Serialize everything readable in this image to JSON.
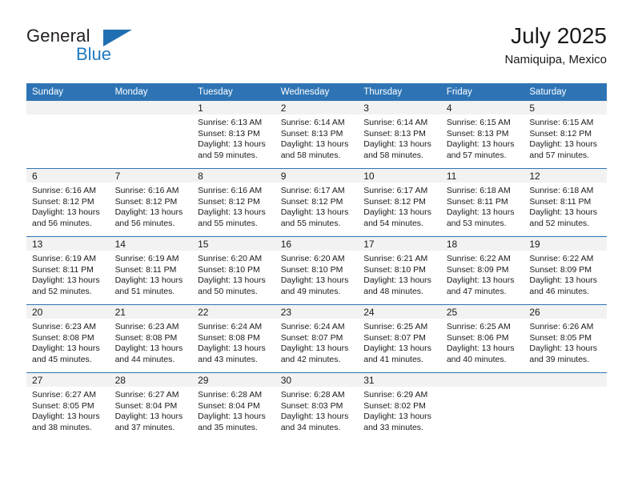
{
  "brand": {
    "name_part1": "General",
    "name_part2": "Blue",
    "triangle_color": "#1f6fb2",
    "blue_text_color": "#1f7ac0"
  },
  "header": {
    "title": "July 2025",
    "subtitle": "Namiquipa, Mexico"
  },
  "theme": {
    "header_blue": "#2e74b5",
    "band_gray": "#f2f2f2",
    "text": "#1a1a1a"
  },
  "calendar": {
    "weekday_headers": [
      "Sunday",
      "Monday",
      "Tuesday",
      "Wednesday",
      "Thursday",
      "Friday",
      "Saturday"
    ],
    "weeks": [
      [
        {
          "day": "",
          "sunrise": "",
          "sunset": "",
          "daylight": ""
        },
        {
          "day": "",
          "sunrise": "",
          "sunset": "",
          "daylight": ""
        },
        {
          "day": "1",
          "sunrise": "Sunrise: 6:13 AM",
          "sunset": "Sunset: 8:13 PM",
          "daylight": "Daylight: 13 hours and 59 minutes."
        },
        {
          "day": "2",
          "sunrise": "Sunrise: 6:14 AM",
          "sunset": "Sunset: 8:13 PM",
          "daylight": "Daylight: 13 hours and 58 minutes."
        },
        {
          "day": "3",
          "sunrise": "Sunrise: 6:14 AM",
          "sunset": "Sunset: 8:13 PM",
          "daylight": "Daylight: 13 hours and 58 minutes."
        },
        {
          "day": "4",
          "sunrise": "Sunrise: 6:15 AM",
          "sunset": "Sunset: 8:13 PM",
          "daylight": "Daylight: 13 hours and 57 minutes."
        },
        {
          "day": "5",
          "sunrise": "Sunrise: 6:15 AM",
          "sunset": "Sunset: 8:12 PM",
          "daylight": "Daylight: 13 hours and 57 minutes."
        }
      ],
      [
        {
          "day": "6",
          "sunrise": "Sunrise: 6:16 AM",
          "sunset": "Sunset: 8:12 PM",
          "daylight": "Daylight: 13 hours and 56 minutes."
        },
        {
          "day": "7",
          "sunrise": "Sunrise: 6:16 AM",
          "sunset": "Sunset: 8:12 PM",
          "daylight": "Daylight: 13 hours and 56 minutes."
        },
        {
          "day": "8",
          "sunrise": "Sunrise: 6:16 AM",
          "sunset": "Sunset: 8:12 PM",
          "daylight": "Daylight: 13 hours and 55 minutes."
        },
        {
          "day": "9",
          "sunrise": "Sunrise: 6:17 AM",
          "sunset": "Sunset: 8:12 PM",
          "daylight": "Daylight: 13 hours and 55 minutes."
        },
        {
          "day": "10",
          "sunrise": "Sunrise: 6:17 AM",
          "sunset": "Sunset: 8:12 PM",
          "daylight": "Daylight: 13 hours and 54 minutes."
        },
        {
          "day": "11",
          "sunrise": "Sunrise: 6:18 AM",
          "sunset": "Sunset: 8:11 PM",
          "daylight": "Daylight: 13 hours and 53 minutes."
        },
        {
          "day": "12",
          "sunrise": "Sunrise: 6:18 AM",
          "sunset": "Sunset: 8:11 PM",
          "daylight": "Daylight: 13 hours and 52 minutes."
        }
      ],
      [
        {
          "day": "13",
          "sunrise": "Sunrise: 6:19 AM",
          "sunset": "Sunset: 8:11 PM",
          "daylight": "Daylight: 13 hours and 52 minutes."
        },
        {
          "day": "14",
          "sunrise": "Sunrise: 6:19 AM",
          "sunset": "Sunset: 8:11 PM",
          "daylight": "Daylight: 13 hours and 51 minutes."
        },
        {
          "day": "15",
          "sunrise": "Sunrise: 6:20 AM",
          "sunset": "Sunset: 8:10 PM",
          "daylight": "Daylight: 13 hours and 50 minutes."
        },
        {
          "day": "16",
          "sunrise": "Sunrise: 6:20 AM",
          "sunset": "Sunset: 8:10 PM",
          "daylight": "Daylight: 13 hours and 49 minutes."
        },
        {
          "day": "17",
          "sunrise": "Sunrise: 6:21 AM",
          "sunset": "Sunset: 8:10 PM",
          "daylight": "Daylight: 13 hours and 48 minutes."
        },
        {
          "day": "18",
          "sunrise": "Sunrise: 6:22 AM",
          "sunset": "Sunset: 8:09 PM",
          "daylight": "Daylight: 13 hours and 47 minutes."
        },
        {
          "day": "19",
          "sunrise": "Sunrise: 6:22 AM",
          "sunset": "Sunset: 8:09 PM",
          "daylight": "Daylight: 13 hours and 46 minutes."
        }
      ],
      [
        {
          "day": "20",
          "sunrise": "Sunrise: 6:23 AM",
          "sunset": "Sunset: 8:08 PM",
          "daylight": "Daylight: 13 hours and 45 minutes."
        },
        {
          "day": "21",
          "sunrise": "Sunrise: 6:23 AM",
          "sunset": "Sunset: 8:08 PM",
          "daylight": "Daylight: 13 hours and 44 minutes."
        },
        {
          "day": "22",
          "sunrise": "Sunrise: 6:24 AM",
          "sunset": "Sunset: 8:08 PM",
          "daylight": "Daylight: 13 hours and 43 minutes."
        },
        {
          "day": "23",
          "sunrise": "Sunrise: 6:24 AM",
          "sunset": "Sunset: 8:07 PM",
          "daylight": "Daylight: 13 hours and 42 minutes."
        },
        {
          "day": "24",
          "sunrise": "Sunrise: 6:25 AM",
          "sunset": "Sunset: 8:07 PM",
          "daylight": "Daylight: 13 hours and 41 minutes."
        },
        {
          "day": "25",
          "sunrise": "Sunrise: 6:25 AM",
          "sunset": "Sunset: 8:06 PM",
          "daylight": "Daylight: 13 hours and 40 minutes."
        },
        {
          "day": "26",
          "sunrise": "Sunrise: 6:26 AM",
          "sunset": "Sunset: 8:05 PM",
          "daylight": "Daylight: 13 hours and 39 minutes."
        }
      ],
      [
        {
          "day": "27",
          "sunrise": "Sunrise: 6:27 AM",
          "sunset": "Sunset: 8:05 PM",
          "daylight": "Daylight: 13 hours and 38 minutes."
        },
        {
          "day": "28",
          "sunrise": "Sunrise: 6:27 AM",
          "sunset": "Sunset: 8:04 PM",
          "daylight": "Daylight: 13 hours and 37 minutes."
        },
        {
          "day": "29",
          "sunrise": "Sunrise: 6:28 AM",
          "sunset": "Sunset: 8:04 PM",
          "daylight": "Daylight: 13 hours and 35 minutes."
        },
        {
          "day": "30",
          "sunrise": "Sunrise: 6:28 AM",
          "sunset": "Sunset: 8:03 PM",
          "daylight": "Daylight: 13 hours and 34 minutes."
        },
        {
          "day": "31",
          "sunrise": "Sunrise: 6:29 AM",
          "sunset": "Sunset: 8:02 PM",
          "daylight": "Daylight: 13 hours and 33 minutes."
        },
        {
          "day": "",
          "sunrise": "",
          "sunset": "",
          "daylight": ""
        },
        {
          "day": "",
          "sunrise": "",
          "sunset": "",
          "daylight": ""
        }
      ]
    ]
  }
}
